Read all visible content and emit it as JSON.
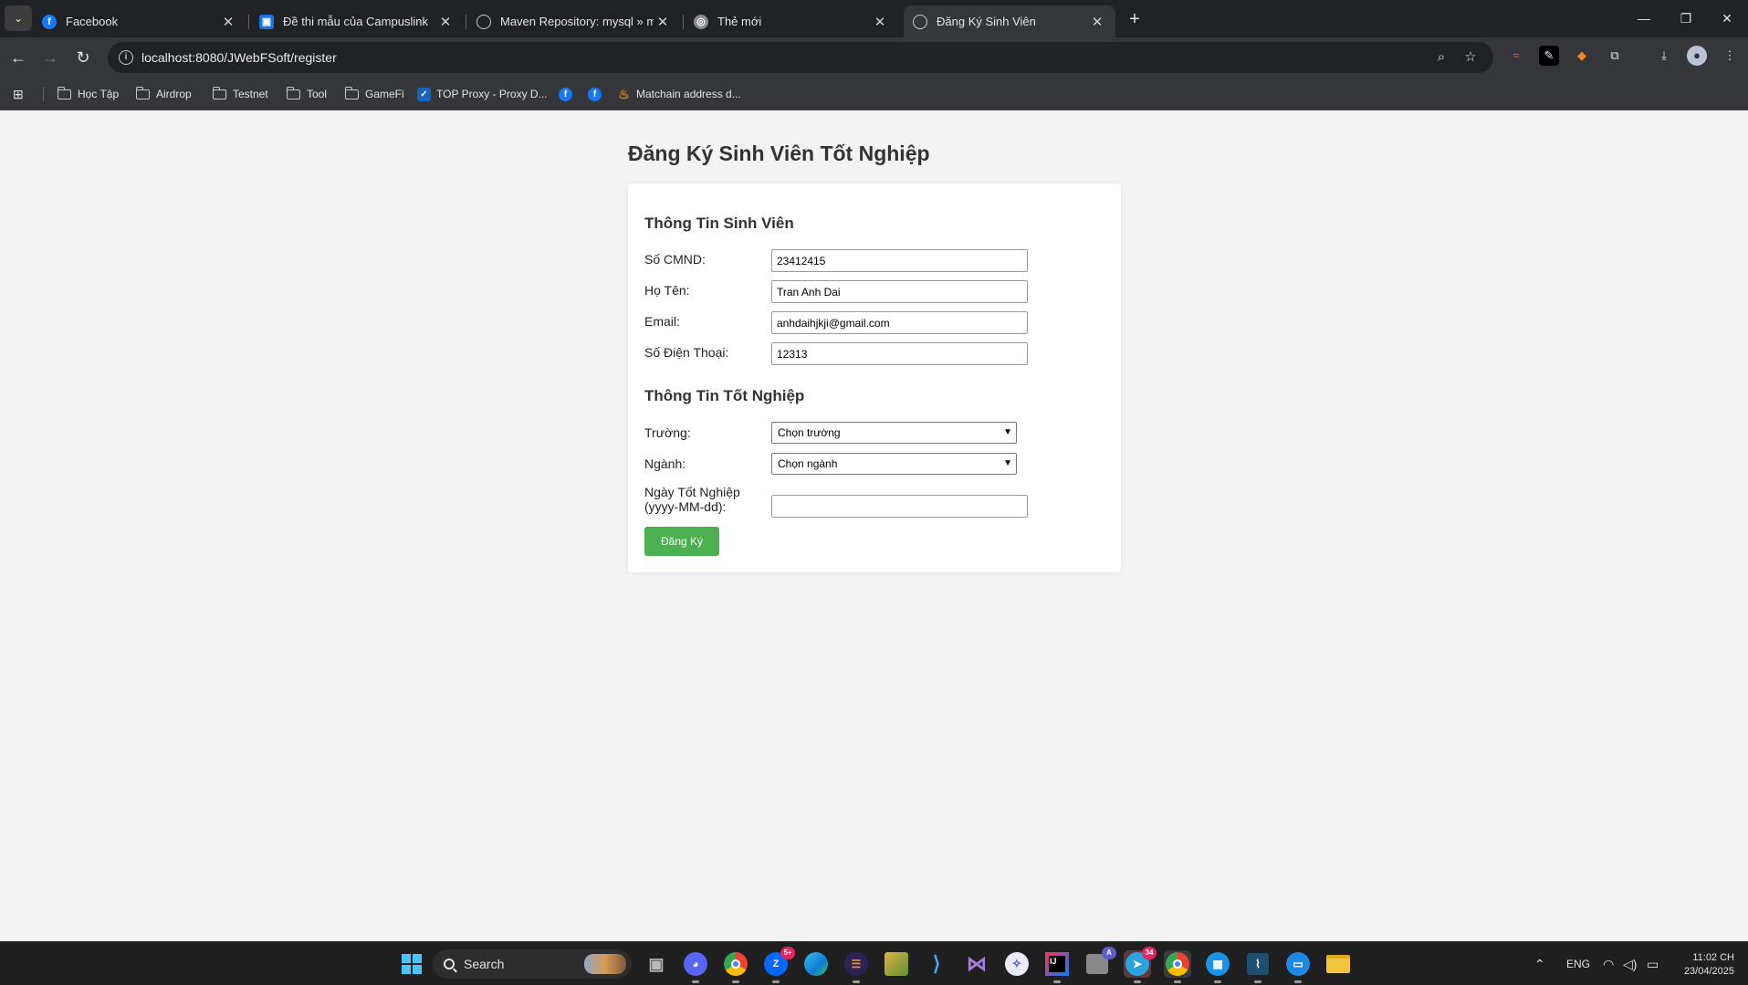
{
  "browser": {
    "tabs": [
      {
        "title": "Facebook",
        "favicon": "facebook-icon",
        "active": false
      },
      {
        "title": "Đề thi mẫu của Campuslink",
        "favicon": "classroom-icon",
        "active": false
      },
      {
        "title": "Maven Repository: mysql » mys",
        "favicon": "globe-icon",
        "active": false
      },
      {
        "title": "Thẻ mới",
        "favicon": "chrome-icon",
        "active": false
      },
      {
        "title": "Đăng Ký Sinh Viên",
        "favicon": "globe-icon",
        "active": true
      }
    ],
    "url": "localhost:8080/JWebFSoft/register",
    "bookmarks": [
      {
        "label": "Học Tập",
        "type": "folder"
      },
      {
        "label": "Airdrop",
        "type": "folder"
      },
      {
        "label": "Testnet",
        "type": "folder"
      },
      {
        "label": "Tool",
        "type": "folder"
      },
      {
        "label": "GameFi",
        "type": "folder"
      },
      {
        "label": "TOP Proxy - Proxy D...",
        "type": "link"
      },
      {
        "label": "",
        "type": "facebook"
      },
      {
        "label": "",
        "type": "facebook"
      },
      {
        "label": "Matchain address d...",
        "type": "link"
      }
    ]
  },
  "page": {
    "title": "Đăng Ký Sinh Viên Tốt Nghiệp",
    "student_section": {
      "title": "Thông Tin Sinh Viên",
      "fields": [
        {
          "label": "Số CMND:",
          "value": "23412415"
        },
        {
          "label": "Họ Tên:",
          "value": "Tran Anh Dai"
        },
        {
          "label": "Email:",
          "value": "anhdaihjkji@gmail.com"
        },
        {
          "label": "Số Điện Thoại:",
          "value": "12313"
        }
      ]
    },
    "graduation_section": {
      "title": "Thông Tin Tốt Nghiệp",
      "school_label": "Trường:",
      "school_selected": "Chọn trường",
      "major_label": "Ngành:",
      "major_selected": "Chọn ngành",
      "date_label_line1": "Ngày Tốt Nghiệp",
      "date_label_line2": "(yyyy-MM-dd):",
      "date_value": ""
    },
    "submit_label": "Đăng Ký",
    "submit_color": "#4caf50"
  },
  "taskbar": {
    "search_label": "Search",
    "language": "ENG",
    "time": "11:02 CH",
    "date": "23/04/2025",
    "badges": {
      "zalo": "5+",
      "telegram": "34",
      "notify": "A"
    }
  }
}
